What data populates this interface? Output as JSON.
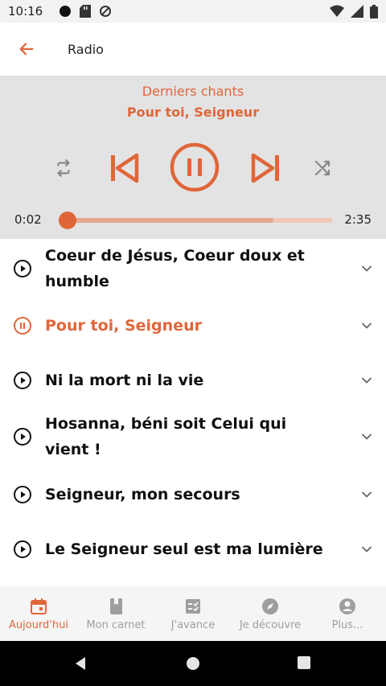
{
  "status": {
    "time": "10:16"
  },
  "appbar": {
    "title": "Radio"
  },
  "player": {
    "playlist_name": "Derniers chants",
    "current_track": "Pour toi, Seigneur",
    "elapsed": "0:02",
    "duration": "2:35",
    "progress_fraction": 0.013,
    "buffered_fraction": 0.78
  },
  "songs": [
    {
      "title": "Coeur de Jésus, Coeur doux et humble",
      "playing": false
    },
    {
      "title": "Pour toi, Seigneur",
      "playing": true
    },
    {
      "title": "Ni la mort ni la vie",
      "playing": false
    },
    {
      "title": "Hosanna, béni soit Celui qui vient !",
      "playing": false
    },
    {
      "title": "Seigneur, mon secours",
      "playing": false
    },
    {
      "title": "Le Seigneur seul est ma lumière",
      "playing": false
    }
  ],
  "nav": [
    {
      "label": "Aujourd'hui",
      "icon": "calendar-icon",
      "active": true
    },
    {
      "label": "Mon carnet",
      "icon": "notebook-icon",
      "active": false
    },
    {
      "label": "J'avance",
      "icon": "checklist-icon",
      "active": false
    },
    {
      "label": "Je découvre",
      "icon": "compass-icon",
      "active": false
    },
    {
      "label": "Plus...",
      "icon": "account-icon",
      "active": false
    }
  ],
  "colors": {
    "accent": "#e0663a",
    "player_bg": "#e3e3e3",
    "nav_bg": "#f5f5f5",
    "inactive": "#9e9e9e"
  }
}
